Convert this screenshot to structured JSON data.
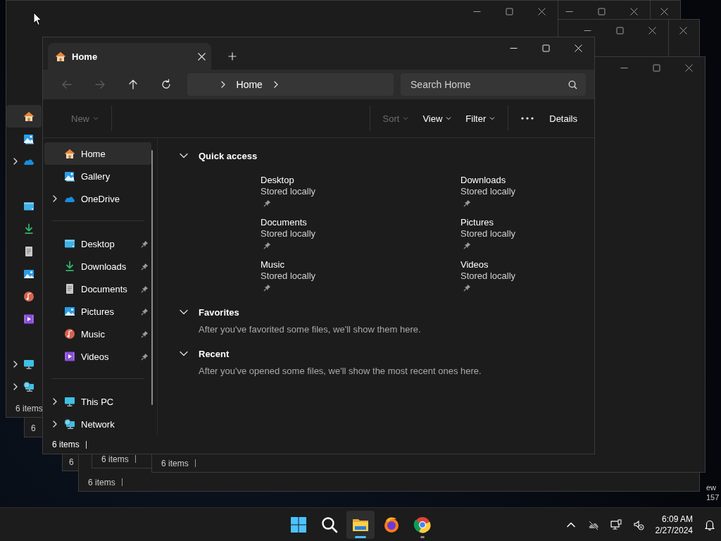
{
  "desktop_fragments": [
    "ew",
    "157"
  ],
  "back_windows": [
    {
      "status": "6 items",
      "sidebar": [
        {
          "selected": true,
          "expandable": false
        },
        {
          "selected": false,
          "expandable": false
        },
        {
          "selected": false,
          "expandable": true
        },
        {
          "selected": false,
          "expandable": false
        },
        {
          "selected": false,
          "expandable": false
        },
        {
          "selected": false,
          "expandable": false
        },
        {
          "selected": false,
          "expandable": false
        },
        {
          "selected": false,
          "expandable": false
        },
        {
          "selected": false,
          "expandable": false
        },
        {
          "selected": false,
          "expandable": true
        },
        {
          "selected": false,
          "expandable": true
        }
      ]
    },
    {
      "status": "6"
    },
    {
      "status": "6"
    },
    {
      "status": "6 items"
    },
    {
      "status": "6 items"
    },
    {
      "status": "6 items"
    }
  ],
  "window": {
    "tabs": [
      {
        "label": "Home",
        "selected": true
      }
    ],
    "nav_buttons": [
      {
        "disabled": true
      },
      {
        "disabled": true
      },
      {
        "disabled": false
      },
      {
        "disabled": false
      }
    ],
    "breadcrumb": [
      "Home"
    ],
    "search": {
      "placeholder": "Search Home"
    },
    "commands_left": [
      {
        "kind": "text",
        "label": "New",
        "disabled": true,
        "dropdown": true
      }
    ],
    "commands_right": [
      {
        "kind": "text",
        "label": "Sort",
        "disabled": true,
        "dropdown": true
      },
      {
        "kind": "text",
        "label": "View",
        "disabled": false,
        "dropdown": true
      },
      {
        "kind": "text",
        "label": "Filter",
        "disabled": false,
        "dropdown": true
      },
      {
        "kind": "more"
      },
      {
        "kind": "text",
        "label": "Details",
        "disabled": false,
        "dropdown": false
      }
    ],
    "sidebar": {
      "groups": [
        [
          {
            "label": "Home",
            "selected": true,
            "expandable": false,
            "pinned": false
          },
          {
            "label": "Gallery",
            "selected": false,
            "expandable": false,
            "pinned": false
          },
          {
            "label": "OneDrive",
            "selected": false,
            "expandable": true,
            "pinned": false
          }
        ],
        [
          {
            "label": "Desktop",
            "selected": false,
            "expandable": false,
            "pinned": true
          },
          {
            "label": "Downloads",
            "selected": false,
            "expandable": false,
            "pinned": true
          },
          {
            "label": "Documents",
            "selected": false,
            "expandable": false,
            "pinned": true
          },
          {
            "label": "Pictures",
            "selected": false,
            "expandable": false,
            "pinned": true
          },
          {
            "label": "Music",
            "selected": false,
            "expandable": false,
            "pinned": true
          },
          {
            "label": "Videos",
            "selected": false,
            "expandable": false,
            "pinned": true
          }
        ],
        [
          {
            "label": "This PC",
            "selected": false,
            "expandable": true,
            "pinned": false
          },
          {
            "label": "Network",
            "selected": false,
            "expandable": true,
            "pinned": false
          }
        ]
      ]
    },
    "sections": [
      {
        "title": "Quick access",
        "expanded": true,
        "tiles": [
          {
            "name": "Desktop",
            "subtitle": "Stored locally",
            "pinned": true
          },
          {
            "name": "Downloads",
            "subtitle": "Stored locally",
            "pinned": true
          },
          {
            "name": "Documents",
            "subtitle": "Stored locally",
            "pinned": true
          },
          {
            "name": "Pictures",
            "subtitle": "Stored locally",
            "pinned": true
          },
          {
            "name": "Music",
            "subtitle": "Stored locally",
            "pinned": true
          },
          {
            "name": "Videos",
            "subtitle": "Stored locally",
            "pinned": true
          }
        ]
      },
      {
        "title": "Favorites",
        "expanded": true,
        "message": "After you've favorited some files, we'll show them here."
      },
      {
        "title": "Recent",
        "expanded": true,
        "message": "After you've opened some files, we'll show the most recent ones here."
      }
    ],
    "status_bar": {
      "item_count": "6 items"
    }
  },
  "taskbar": {
    "apps": [
      {
        "running": false,
        "active": false
      },
      {
        "running": false,
        "active": false
      },
      {
        "running": true,
        "active": true
      },
      {
        "running": false,
        "active": false
      },
      {
        "running": true,
        "active": false
      }
    ],
    "clock": {
      "time": "6:09 AM",
      "date": "2/27/2024"
    }
  }
}
